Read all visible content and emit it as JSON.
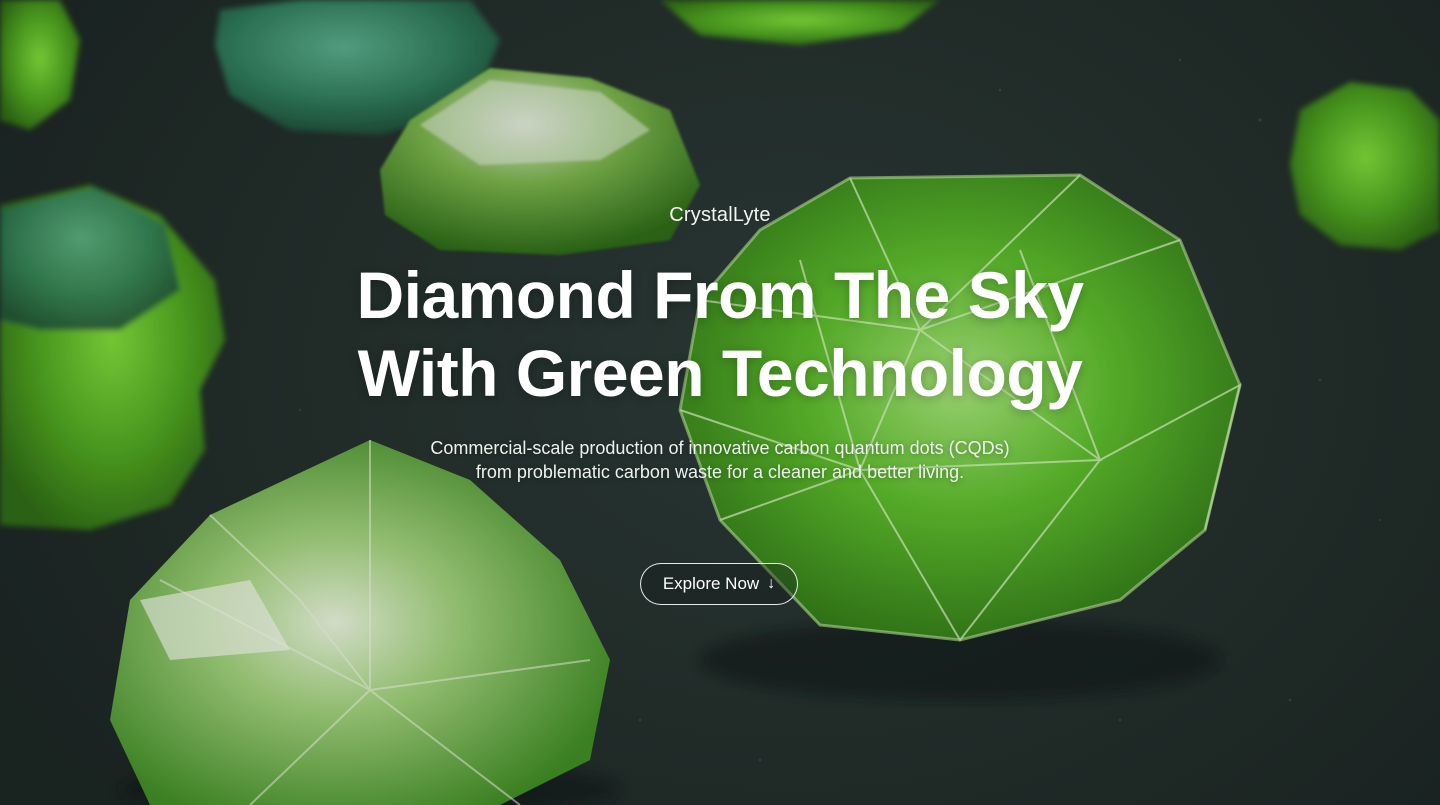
{
  "hero": {
    "brand": "CrystalLyte",
    "headline_line1": "Diamond From The Sky",
    "headline_line2": "With Green Technology",
    "subtext_line1": "Commercial-scale production of innovative carbon quantum dots (CQDs)",
    "subtext_line2": "from problematic carbon waste for a cleaner and better living.",
    "cta_label": "Explore Now",
    "cta_icon": "arrow-down-icon",
    "cta_arrow": "↓"
  },
  "colors": {
    "background": "#25312e",
    "crystal_green": "#5fbf2a",
    "text": "#ffffff"
  }
}
